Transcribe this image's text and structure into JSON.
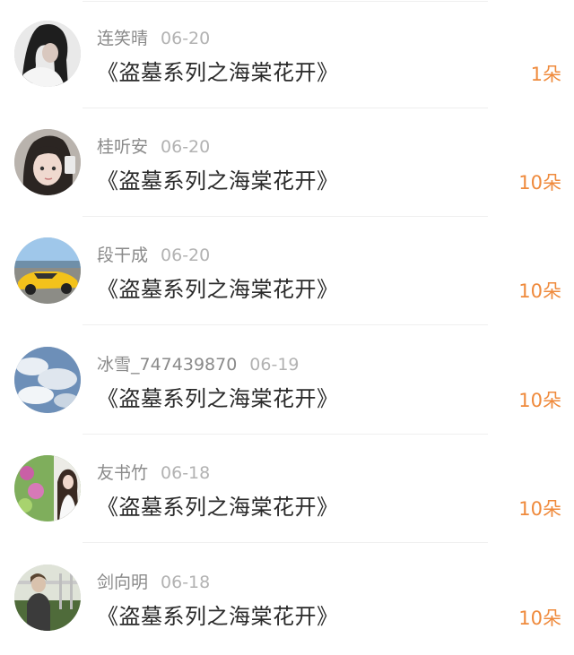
{
  "gift_list": {
    "items": [
      {
        "name": "连笑晴",
        "date": "06-20",
        "title": "《盗墓系列之海棠花开》",
        "amount": "1朵",
        "avatar_icon": "avatar-girl-dark-hair-icon"
      },
      {
        "name": "桂听安",
        "date": "06-20",
        "title": "《盗墓系列之海棠花开》",
        "amount": "10朵",
        "avatar_icon": "avatar-girl-bangs-icon"
      },
      {
        "name": "段干成",
        "date": "06-20",
        "title": "《盗墓系列之海棠花开》",
        "amount": "10朵",
        "avatar_icon": "avatar-yellow-car-icon"
      },
      {
        "name": "冰雪_747439870",
        "date": "06-19",
        "title": "《盗墓系列之海棠花开》",
        "amount": "10朵",
        "avatar_icon": "avatar-cloudy-sky-icon"
      },
      {
        "name": "友书竹",
        "date": "06-18",
        "title": "《盗墓系列之海棠花开》",
        "amount": "10朵",
        "avatar_icon": "avatar-flowers-girl-icon"
      },
      {
        "name": "剑向明",
        "date": "06-18",
        "title": "《盗墓系列之海棠花开》",
        "amount": "10朵",
        "avatar_icon": "avatar-person-outdoor-icon"
      }
    ]
  },
  "colors": {
    "name": "#8a8a8a",
    "date": "#b2b2b2",
    "title": "#2a2a2a",
    "amount": "#ef8a3c",
    "divider": "#efefef"
  }
}
